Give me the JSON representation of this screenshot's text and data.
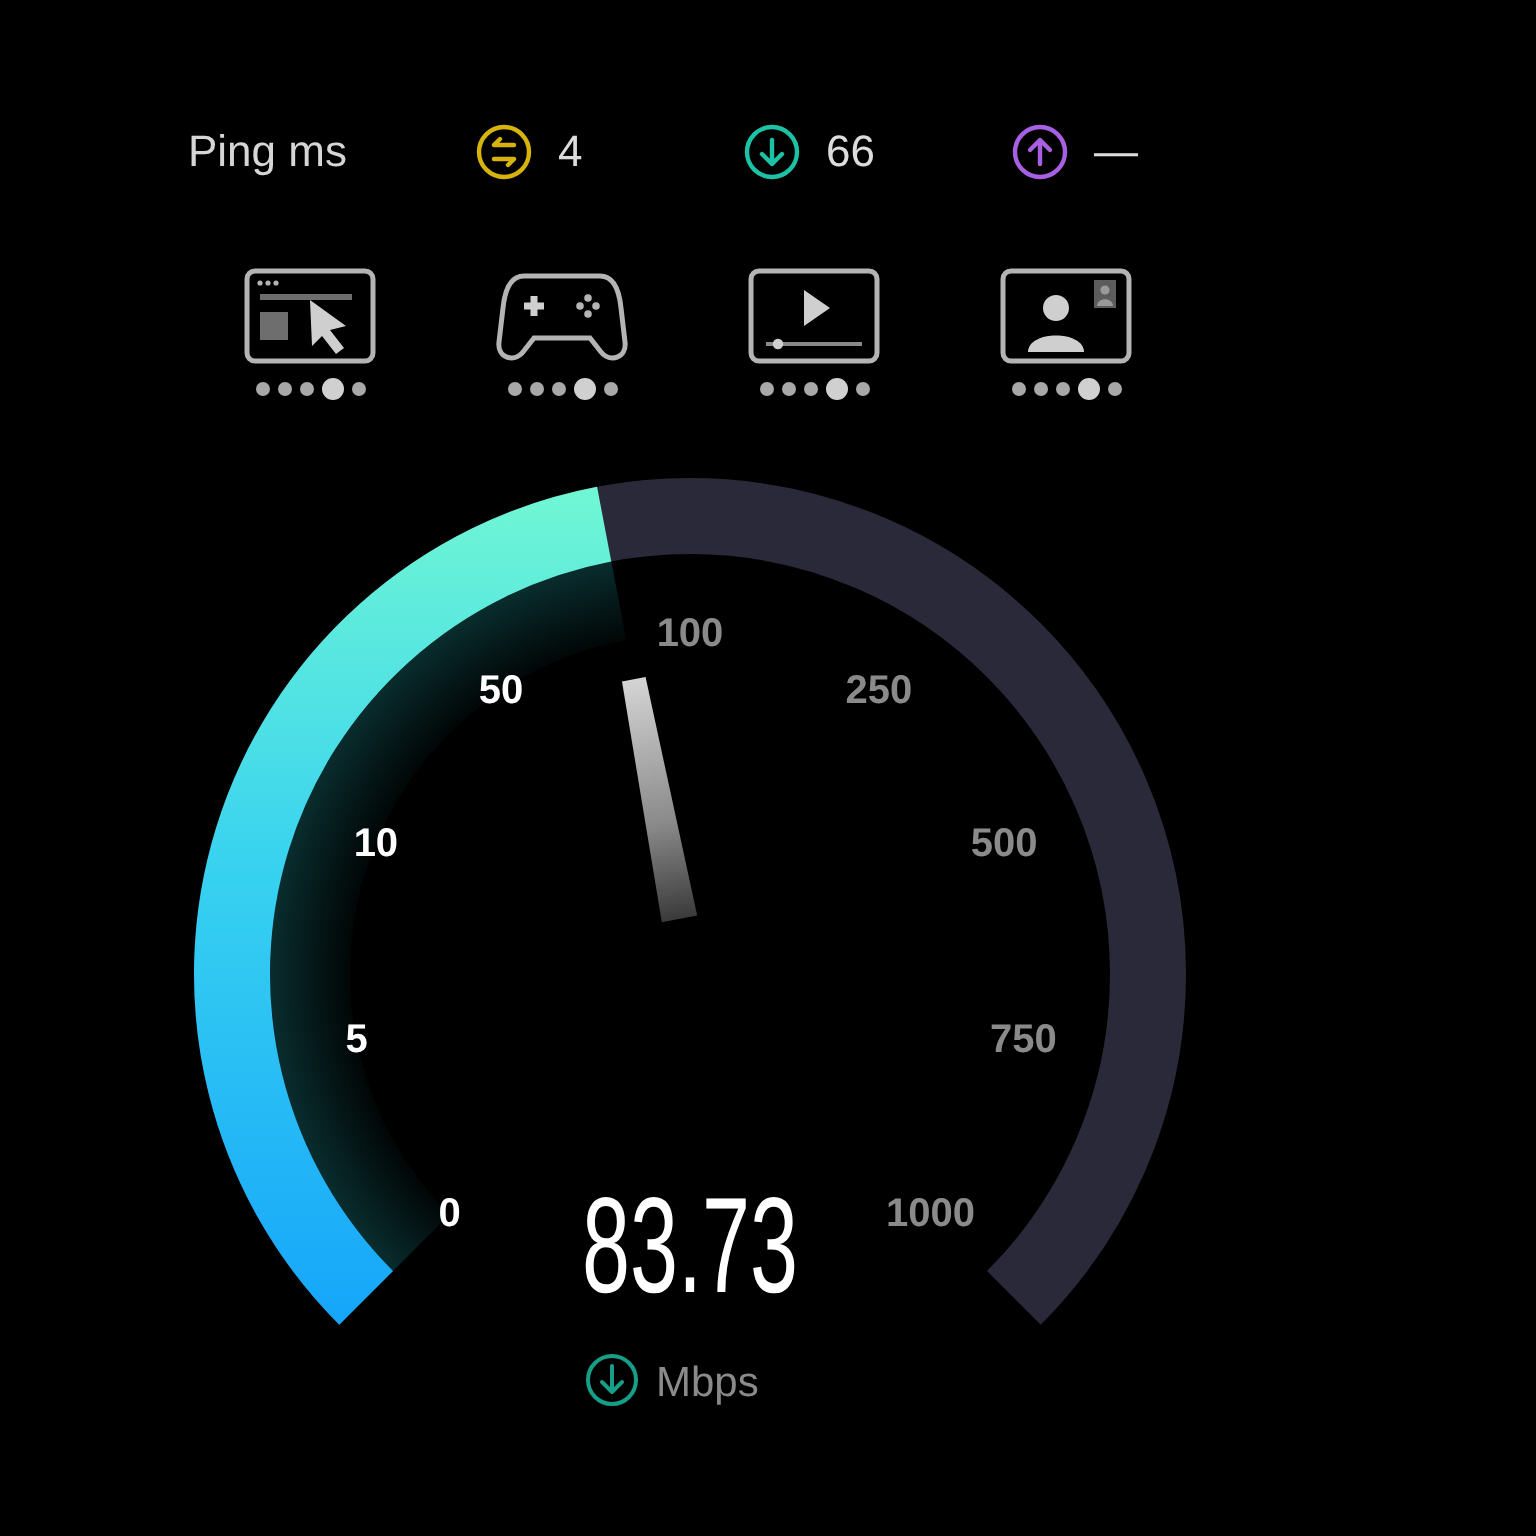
{
  "ping": {
    "label": "Ping ms"
  },
  "stats": [
    {
      "kind": "idle",
      "value": "4",
      "color": "#d6b40c"
    },
    {
      "kind": "download",
      "value": "66",
      "color": "#1cc2a5"
    },
    {
      "kind": "upload",
      "value": "—",
      "color": "#a760e2"
    }
  ],
  "activities": [
    {
      "kind": "browsing",
      "dots": [
        {
          "selected": false
        },
        {
          "selected": false
        },
        {
          "selected": false
        },
        {
          "selected": true
        },
        {
          "selected": false
        }
      ]
    },
    {
      "kind": "gaming",
      "dots": [
        {
          "selected": false
        },
        {
          "selected": false
        },
        {
          "selected": false
        },
        {
          "selected": true
        },
        {
          "selected": false
        }
      ]
    },
    {
      "kind": "streaming",
      "dots": [
        {
          "selected": false
        },
        {
          "selected": false
        },
        {
          "selected": false
        },
        {
          "selected": true
        },
        {
          "selected": false
        }
      ]
    },
    {
      "kind": "video_call",
      "dots": [
        {
          "selected": false
        },
        {
          "selected": false
        },
        {
          "selected": false
        },
        {
          "selected": true
        },
        {
          "selected": false
        }
      ]
    }
  ],
  "gauge": {
    "level": 0.46,
    "ticks": [
      {
        "label": "0",
        "reached": true
      },
      {
        "label": "5",
        "reached": true
      },
      {
        "label": "10",
        "reached": true
      },
      {
        "label": "50",
        "reached": true
      },
      {
        "label": "100",
        "reached": false
      },
      {
        "label": "250",
        "reached": false
      },
      {
        "label": "500",
        "reached": false
      },
      {
        "label": "750",
        "reached": false
      },
      {
        "label": "1000",
        "reached": false
      }
    ],
    "value": "83.73",
    "unit": "Mbps"
  }
}
